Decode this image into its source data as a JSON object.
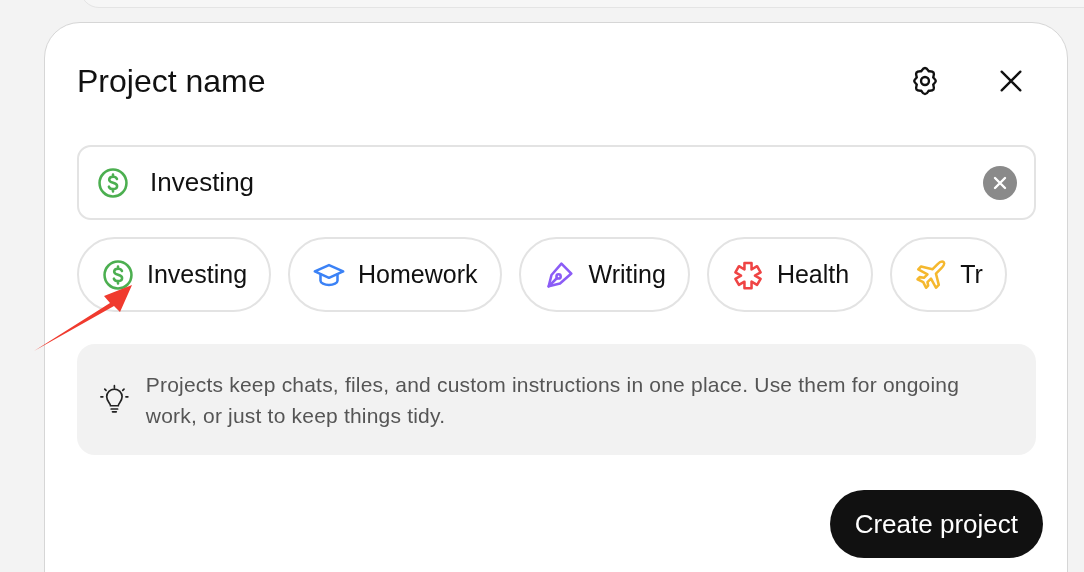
{
  "dialog": {
    "title": "Project name"
  },
  "name_field": {
    "value": "Investing",
    "kind": "dollar",
    "color": "#4caf50"
  },
  "categories": [
    {
      "kind": "dollar",
      "label": "Investing",
      "color": "#4caf50"
    },
    {
      "kind": "cap",
      "label": "Homework",
      "color": "#3b82f6"
    },
    {
      "kind": "pen",
      "label": "Writing",
      "color": "#8b5cf6"
    },
    {
      "kind": "cross",
      "label": "Health",
      "color": "#ef4444"
    },
    {
      "kind": "plane",
      "label": "Tr",
      "color": "#f5b82e"
    }
  ],
  "tip": "Projects keep chats, files, and custom instructions in one place. Use them for ongoing work, or just to keep things tidy.",
  "create_button": "Create project"
}
